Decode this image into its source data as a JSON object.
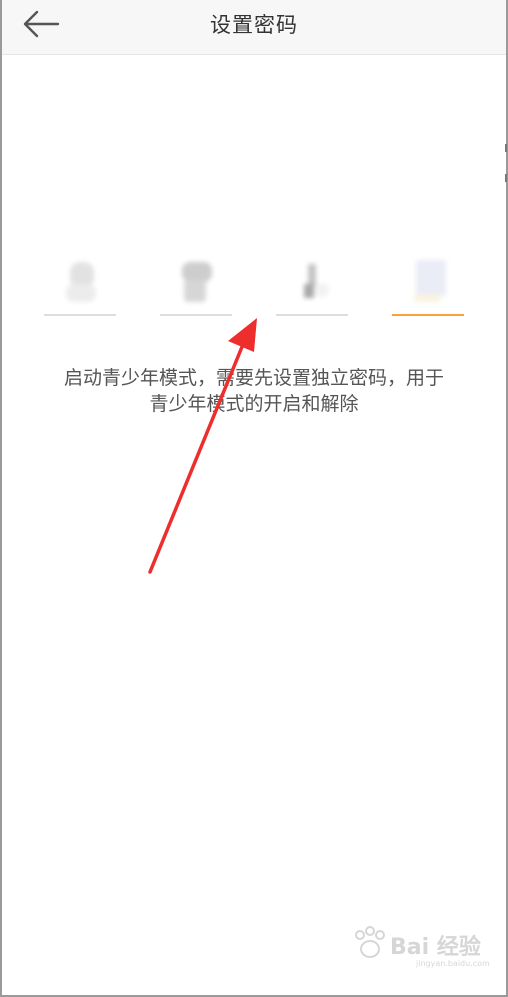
{
  "header": {
    "title": "设置密码",
    "back_icon": "arrow-left-icon"
  },
  "pin": {
    "length": 4,
    "active_index": 3,
    "active_color": "#f5a33a",
    "inactive_color": "#dddddd"
  },
  "description": {
    "line1": "启动青少年模式，需要先设置独立密码，用于",
    "line2": "青少年模式的开启和解除"
  },
  "annotation": {
    "arrow_color": "#ee2d2d",
    "icon": "red-arrow-icon"
  },
  "watermark": {
    "text": "Bai 经验",
    "sub": "jingyan.baidu.com"
  }
}
